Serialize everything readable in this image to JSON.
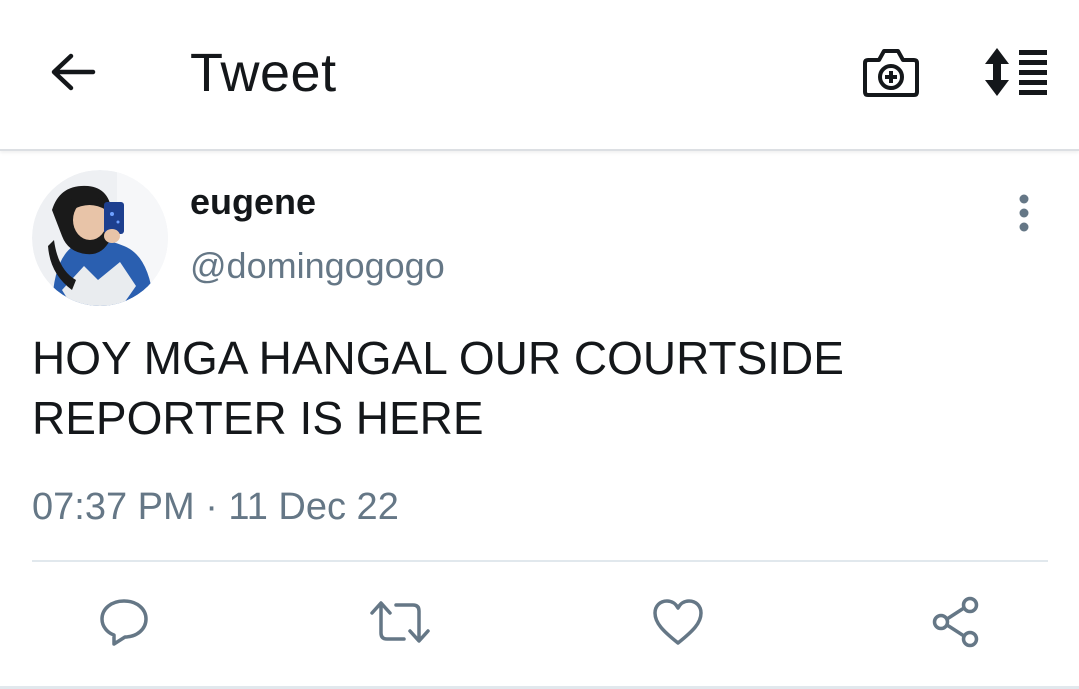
{
  "header": {
    "title": "Tweet",
    "back_icon": "arrow-left-icon",
    "camera_icon": "camera-plus-icon",
    "sort_icon": "sort-list-icon"
  },
  "tweet": {
    "display_name": "eugene",
    "username": "@domingogogo",
    "text": "HOY MGA HANGAL OUR COURTSIDE REPORTER IS HERE",
    "timestamp": "07:37 PM · 11 Dec 22"
  },
  "actions": [
    "reply-icon",
    "retweet-icon",
    "like-icon",
    "share-icon"
  ],
  "colors": {
    "text_primary": "#14171a",
    "text_secondary": "#657786",
    "divider": "#e1e8ed"
  }
}
